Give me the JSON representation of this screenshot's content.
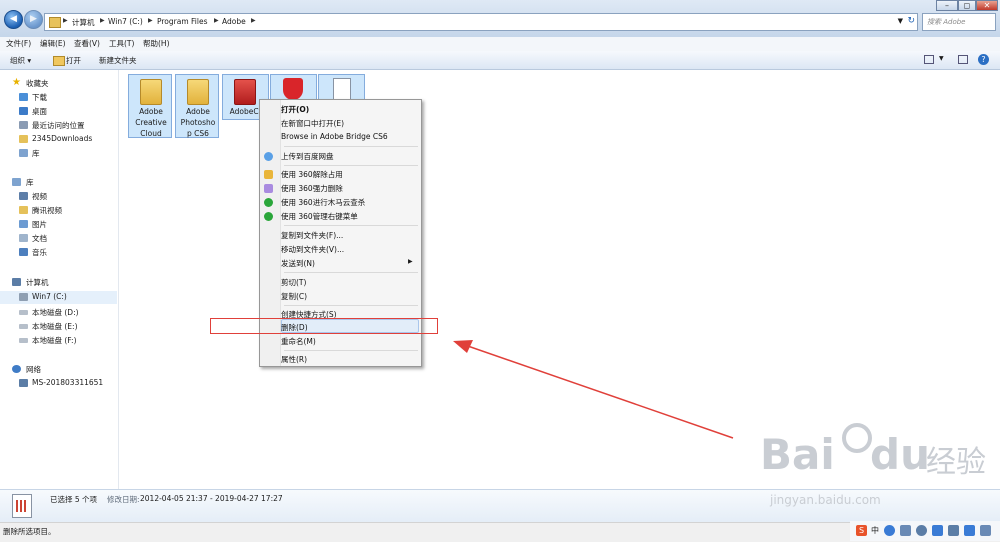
{
  "address": {
    "crumbs": [
      "计算机",
      "Win7 (C:)",
      "Program Files",
      "Adobe"
    ],
    "search_placeholder": "搜索 Adobe"
  },
  "menubar": [
    "文件(F)",
    "编辑(E)",
    "查看(V)",
    "工具(T)",
    "帮助(H)"
  ],
  "toolbar": {
    "organize": "组织 ▾",
    "open": "打开",
    "new_folder": "新建文件夹"
  },
  "navpane": {
    "favorites": {
      "title": "收藏夹",
      "items": [
        "下载",
        "桌面",
        "最近访问的位置",
        "2345Downloads",
        "库"
      ]
    },
    "libraries": {
      "title": "库",
      "items": [
        "视频",
        "腾讯视频",
        "图片",
        "文档",
        "音乐"
      ]
    },
    "computer": {
      "title": "计算机",
      "items": [
        "Win7 (C:)",
        "本地磁盘 (D:)",
        "本地磁盘 (E:)",
        "本地磁盘 (F:)"
      ]
    },
    "network": {
      "title": "网络",
      "items": [
        "MS-201803311651"
      ]
    }
  },
  "files": [
    {
      "line1": "Adobe",
      "line2": "Creative",
      "line3": "Cloud"
    },
    {
      "line1": "Adobe",
      "line2": "Photosho",
      "line3": "p CS6"
    },
    {
      "line1": "AdobeCS",
      "line2": "",
      "line3": ""
    }
  ],
  "context_menu": {
    "open": "打开(O)",
    "open_new_window": "在新窗口中打开(E)",
    "bridge": "Browse in Adobe Bridge CS6",
    "baidu_upload": "上传到百度网盘",
    "unlock_360": "使用 360解除占用",
    "force_delete_360": "使用 360强力删除",
    "trojan_scan_360": "使用 360进行木马云查杀",
    "manage_menu_360": "使用 360管理右键菜单",
    "copy_to": "复制到文件夹(F)...",
    "move_to": "移动到文件夹(V)...",
    "send_to": "发送到(N)",
    "cut": "剪切(T)",
    "copy": "复制(C)",
    "create_shortcut": "创建快捷方式(S)",
    "delete": "删除(D)",
    "rename": "重命名(M)",
    "properties": "属性(R)"
  },
  "details": {
    "selected": "已选择 5 个项",
    "modified_label": "修改日期:",
    "modified_value": "2012-04-05 21:37 - 2019-04-27 17:27"
  },
  "statusbar": {
    "text": "删除所选项目。"
  },
  "tray": {
    "ime": "中"
  },
  "watermark": {
    "brand": "Bai",
    "brand2": "du",
    "cn": "经验",
    "url": "jingyan.baidu.com"
  },
  "colors": {
    "highlight_red": "#e0403a",
    "selection_blue": "#cde6fb",
    "accent": "#1b5fb3"
  }
}
